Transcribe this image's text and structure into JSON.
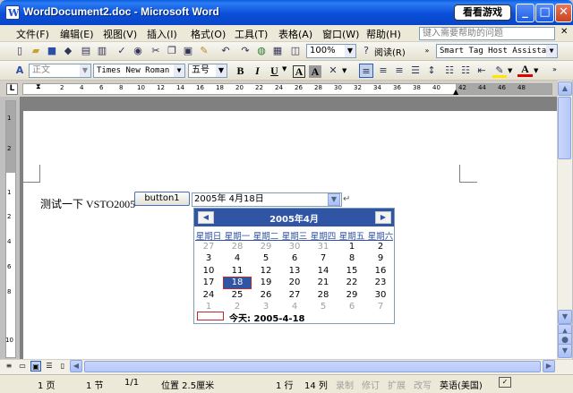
{
  "window": {
    "title": "WordDocument2.doc - Microsoft Word",
    "app_icon_letter": "W",
    "badge": "看看游戏",
    "controls": {
      "minimize": "_",
      "maximize": "□",
      "close": "✕"
    }
  },
  "menubar": {
    "items": [
      "文件(F)",
      "编辑(E)",
      "视图(V)",
      "插入(I)",
      "格式(O)",
      "工具(T)",
      "表格(A)",
      "窗口(W)",
      "帮助(H)"
    ],
    "help_placeholder": "键入需要帮助的问题",
    "help_close": "✕"
  },
  "toolbar1": {
    "zoom": "100%",
    "read_label": "阅读(R)",
    "smarttag": "Smart Tag Host Assistant"
  },
  "toolbar2": {
    "style": "正文",
    "font": "Times New Roman",
    "size": "五号",
    "bold": "B",
    "italic": "I",
    "underline": "U",
    "char_border": "A",
    "char_shading": "A",
    "font_color": "A"
  },
  "ruler": {
    "ticks": [
      "2",
      "4",
      "6",
      "8",
      "10",
      "12",
      "14",
      "16",
      "18",
      "20",
      "22",
      "24",
      "26",
      "28",
      "30",
      "32",
      "34",
      "36",
      "38",
      "40",
      "42",
      "44",
      "46",
      "48"
    ],
    "corner": "L",
    "vticks": [
      "1",
      "2",
      "1",
      "2",
      "4",
      "6",
      "8",
      "10"
    ]
  },
  "document": {
    "text": "测试一下 VSTO2005",
    "button_label": "button1",
    "date_value": "2005年  4月18日",
    "para_mark": "↵"
  },
  "calendar": {
    "title": "2005年4月",
    "prev": "◀",
    "next": "▶",
    "weekdays": [
      "星期日",
      "星期一",
      "星期二",
      "星期三",
      "星期四",
      "星期五",
      "星期六"
    ],
    "weeks": [
      [
        "27",
        "28",
        "29",
        "30",
        "31",
        "1",
        "2"
      ],
      [
        "3",
        "4",
        "5",
        "6",
        "7",
        "8",
        "9"
      ],
      [
        "10",
        "11",
        "12",
        "13",
        "14",
        "15",
        "16"
      ],
      [
        "17",
        "18",
        "19",
        "20",
        "21",
        "22",
        "23"
      ],
      [
        "24",
        "25",
        "26",
        "27",
        "28",
        "29",
        "30"
      ],
      [
        "1",
        "2",
        "3",
        "4",
        "5",
        "6",
        "7"
      ]
    ],
    "selected": "18",
    "today_label": "今天: 2005-4-18"
  },
  "statusbar": {
    "page": "1 页",
    "section": "1 节",
    "pages": "1/1",
    "position": "位置 2.5厘米",
    "line": "1 行",
    "column": "14 列",
    "rec": "录制",
    "trk": "修订",
    "ext": "扩展",
    "ovr": "改写",
    "language": "英语(美国)"
  },
  "colors": {
    "titlebar": "#0a4fd8",
    "calendar_header": "#3155a5",
    "selection_border": "#c0282d",
    "chrome": "#ece9d8"
  }
}
